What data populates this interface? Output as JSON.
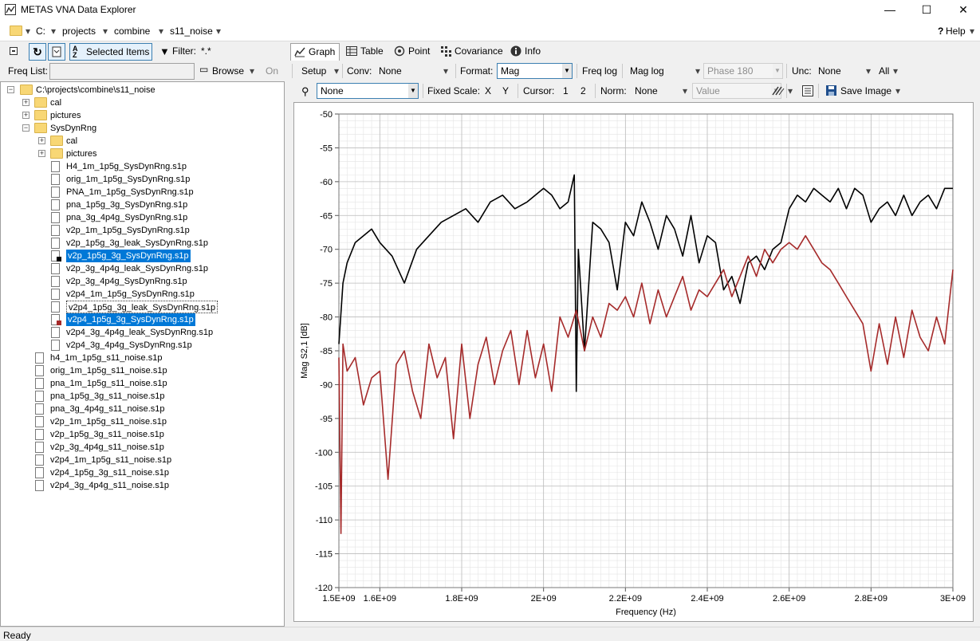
{
  "window": {
    "title": "METAS VNA Data Explorer",
    "minimize": "—",
    "maximize": "☐",
    "close": "✕"
  },
  "address": {
    "items": [
      "C:",
      "projects",
      "combine",
      "s11_noise"
    ],
    "help": "Help",
    "help_prefix": "?"
  },
  "left_toolbar": {
    "selected_items": "Selected Items",
    "filter_label": "Filter:",
    "filter_value": "*.*"
  },
  "freq_list": {
    "label": "Freq List:",
    "value": "",
    "browse": "Browse",
    "on": "On"
  },
  "tree": {
    "root": "C:\\projects\\combine\\s11_noise",
    "nodes": [
      {
        "label": "cal",
        "type": "folder",
        "level": 1,
        "expander": "+"
      },
      {
        "label": "pictures",
        "type": "folder",
        "level": 1,
        "expander": "+"
      },
      {
        "label": "SysDynRng",
        "type": "folder",
        "level": 1,
        "expander": "−"
      },
      {
        "label": "cal",
        "type": "folder",
        "level": 2,
        "expander": "+"
      },
      {
        "label": "pictures",
        "type": "folder",
        "level": 2,
        "expander": "+"
      },
      {
        "label": "H4_1m_1p5g_SysDynRng.s1p",
        "type": "file",
        "level": 2
      },
      {
        "label": "orig_1m_1p5g_SysDynRng.s1p",
        "type": "file",
        "level": 2
      },
      {
        "label": "PNA_1m_1p5g_SysDynRng.s1p",
        "type": "file",
        "level": 2
      },
      {
        "label": "pna_1p5g_3g_SysDynRng.s1p",
        "type": "file",
        "level": 2
      },
      {
        "label": "pna_3g_4p4g_SysDynRng.s1p",
        "type": "file",
        "level": 2
      },
      {
        "label": "v2p_1m_1p5g_SysDynRng.s1p",
        "type": "file",
        "level": 2
      },
      {
        "label": "v2p_1p5g_3g_leak_SysDynRng.s1p",
        "type": "file",
        "level": 2
      },
      {
        "label": "v2p_1p5g_3g_SysDynRng.s1p",
        "type": "file",
        "level": 2,
        "state": "sel",
        "marker": "#000000"
      },
      {
        "label": "v2p_3g_4p4g_leak_SysDynRng.s1p",
        "type": "file",
        "level": 2
      },
      {
        "label": "v2p_3g_4p4g_SysDynRng.s1p",
        "type": "file",
        "level": 2
      },
      {
        "label": "v2p4_1m_1p5g_SysDynRng.s1p",
        "type": "file",
        "level": 2
      },
      {
        "label": "v2p4_1p5g_3g_leak_SysDynRng.s1p",
        "type": "file",
        "level": 2,
        "state": "dot"
      },
      {
        "label": "v2p4_1p5g_3g_SysDynRng.s1p",
        "type": "file",
        "level": 2,
        "state": "sel",
        "marker": "#a52a2a"
      },
      {
        "label": "v2p4_3g_4p4g_leak_SysDynRng.s1p",
        "type": "file",
        "level": 2
      },
      {
        "label": "v2p4_3g_4p4g_SysDynRng.s1p",
        "type": "file",
        "level": 2
      },
      {
        "label": "h4_1m_1p5g_s11_noise.s1p",
        "type": "file",
        "level": 1
      },
      {
        "label": "orig_1m_1p5g_s11_noise.s1p",
        "type": "file",
        "level": 1
      },
      {
        "label": "pna_1m_1p5g_s11_noise.s1p",
        "type": "file",
        "level": 1
      },
      {
        "label": "pna_1p5g_3g_s11_noise.s1p",
        "type": "file",
        "level": 1
      },
      {
        "label": "pna_3g_4p4g_s11_noise.s1p",
        "type": "file",
        "level": 1
      },
      {
        "label": "v2p_1m_1p5g_s11_noise.s1p",
        "type": "file",
        "level": 1
      },
      {
        "label": "v2p_1p5g_3g_s11_noise.s1p",
        "type": "file",
        "level": 1
      },
      {
        "label": "v2p_3g_4p4g_s11_noise.s1p",
        "type": "file",
        "level": 1
      },
      {
        "label": "v2p4_1m_1p5g_s11_noise.s1p",
        "type": "file",
        "level": 1
      },
      {
        "label": "v2p4_1p5g_3g_s11_noise.s1p",
        "type": "file",
        "level": 1
      },
      {
        "label": "v2p4_3g_4p4g_s11_noise.s1p",
        "type": "file",
        "level": 1
      }
    ]
  },
  "tabs": [
    "Graph",
    "Table",
    "Point",
    "Covariance",
    "Info"
  ],
  "toolbar1": {
    "setup": "Setup",
    "conv_label": "Conv:",
    "conv_value": "None",
    "format_label": "Format:",
    "format_value": "Mag",
    "freq_log": "Freq log",
    "mag_log": "Mag log",
    "phase": "Phase 180",
    "unc_label": "Unc:",
    "unc_value": "None",
    "all": "All"
  },
  "toolbar2": {
    "param_value": "None",
    "fixed_scale": "Fixed Scale:",
    "x": "X",
    "y": "Y",
    "cursor": "Cursor:",
    "c1": "1",
    "c2": "2",
    "norm_label": "Norm:",
    "norm_value": "None",
    "value": "Value",
    "save_image": "Save Image"
  },
  "status": "Ready",
  "chart_data": {
    "type": "line",
    "xlabel": "Frequency (Hz)",
    "ylabel": "Mag S2,1 [dB]",
    "xlim": [
      1500000000,
      3000000000
    ],
    "ylim": [
      -120,
      -50
    ],
    "x_ticks": [
      "1.5E+09",
      "1.6E+09",
      "1.8E+09",
      "2E+09",
      "2.2E+09",
      "2.4E+09",
      "2.6E+09",
      "2.8E+09",
      "3E+09"
    ],
    "x_tick_values": [
      1500000000,
      1600000000,
      1800000000,
      2000000000,
      2200000000,
      2400000000,
      2600000000,
      2800000000,
      3000000000
    ],
    "y_ticks": [
      -50,
      -55,
      -60,
      -65,
      -70,
      -75,
      -80,
      -85,
      -90,
      -95,
      -100,
      -105,
      -110,
      -115,
      -120
    ],
    "grid": true,
    "series": [
      {
        "color": "#000000",
        "x": [
          1500000000,
          1510000000,
          1520000000,
          1540000000,
          1560000000,
          1580000000,
          1600000000,
          1630000000,
          1660000000,
          1690000000,
          1720000000,
          1750000000,
          1780000000,
          1810000000,
          1840000000,
          1870000000,
          1900000000,
          1930000000,
          1960000000,
          1980000000,
          2000000000,
          2020000000,
          2040000000,
          2060000000,
          2075000000,
          2080000000,
          2085000000,
          2100000000,
          2120000000,
          2140000000,
          2160000000,
          2180000000,
          2200000000,
          2220000000,
          2240000000,
          2260000000,
          2280000000,
          2300000000,
          2320000000,
          2340000000,
          2360000000,
          2380000000,
          2400000000,
          2420000000,
          2440000000,
          2460000000,
          2480000000,
          2500000000,
          2520000000,
          2540000000,
          2560000000,
          2580000000,
          2600000000,
          2620000000,
          2640000000,
          2660000000,
          2680000000,
          2700000000,
          2720000000,
          2740000000,
          2760000000,
          2780000000,
          2800000000,
          2820000000,
          2840000000,
          2860000000,
          2880000000,
          2900000000,
          2920000000,
          2940000000,
          2960000000,
          2980000000,
          3000000000
        ],
        "y": [
          -84,
          -75,
          -72,
          -69,
          -68,
          -67,
          -69,
          -71,
          -75,
          -70,
          -68,
          -66,
          -65,
          -64,
          -66,
          -63,
          -62,
          -64,
          -63,
          -62,
          -61,
          -62,
          -64,
          -63,
          -59,
          -91,
          -70,
          -85,
          -66,
          -67,
          -69,
          -76,
          -66,
          -68,
          -63,
          -66,
          -70,
          -65,
          -67,
          -71,
          -65,
          -72,
          -68,
          -69,
          -76,
          -74,
          -78,
          -72,
          -71,
          -73,
          -70,
          -69,
          -64,
          -62,
          -63,
          -61,
          -62,
          -63,
          -61,
          -64,
          -61,
          -62,
          -66,
          -64,
          -63,
          -65,
          -62,
          -65,
          -63,
          -62,
          -64,
          -61,
          -61
        ]
      },
      {
        "color": "#a52a2a",
        "x": [
          1500000000,
          1505000000,
          1510000000,
          1520000000,
          1540000000,
          1560000000,
          1580000000,
          1600000000,
          1620000000,
          1640000000,
          1660000000,
          1680000000,
          1700000000,
          1720000000,
          1740000000,
          1760000000,
          1780000000,
          1800000000,
          1820000000,
          1840000000,
          1860000000,
          1880000000,
          1900000000,
          1920000000,
          1940000000,
          1960000000,
          1980000000,
          2000000000,
          2020000000,
          2040000000,
          2060000000,
          2080000000,
          2100000000,
          2120000000,
          2140000000,
          2160000000,
          2180000000,
          2200000000,
          2220000000,
          2240000000,
          2260000000,
          2280000000,
          2300000000,
          2320000000,
          2340000000,
          2360000000,
          2380000000,
          2400000000,
          2420000000,
          2440000000,
          2460000000,
          2480000000,
          2500000000,
          2520000000,
          2540000000,
          2560000000,
          2580000000,
          2600000000,
          2620000000,
          2640000000,
          2660000000,
          2680000000,
          2700000000,
          2720000000,
          2740000000,
          2760000000,
          2780000000,
          2800000000,
          2820000000,
          2840000000,
          2860000000,
          2880000000,
          2900000000,
          2920000000,
          2940000000,
          2960000000,
          2980000000,
          3000000000
        ],
        "y": [
          -86,
          -112,
          -84,
          -88,
          -86,
          -93,
          -89,
          -88,
          -104,
          -87,
          -85,
          -91,
          -95,
          -84,
          -89,
          -86,
          -98,
          -84,
          -95,
          -87,
          -83,
          -90,
          -85,
          -82,
          -90,
          -82,
          -89,
          -84,
          -91,
          -80,
          -83,
          -79,
          -85,
          -80,
          -83,
          -78,
          -79,
          -77,
          -80,
          -75,
          -81,
          -76,
          -80,
          -77,
          -74,
          -79,
          -76,
          -77,
          -75,
          -73,
          -77,
          -74,
          -71,
          -74,
          -70,
          -72,
          -70,
          -69,
          -70,
          -68,
          -70,
          -72,
          -73,
          -75,
          -77,
          -79,
          -81,
          -88,
          -81,
          -87,
          -80,
          -86,
          -79,
          -83,
          -85,
          -80,
          -84,
          -73
        ]
      }
    ]
  }
}
